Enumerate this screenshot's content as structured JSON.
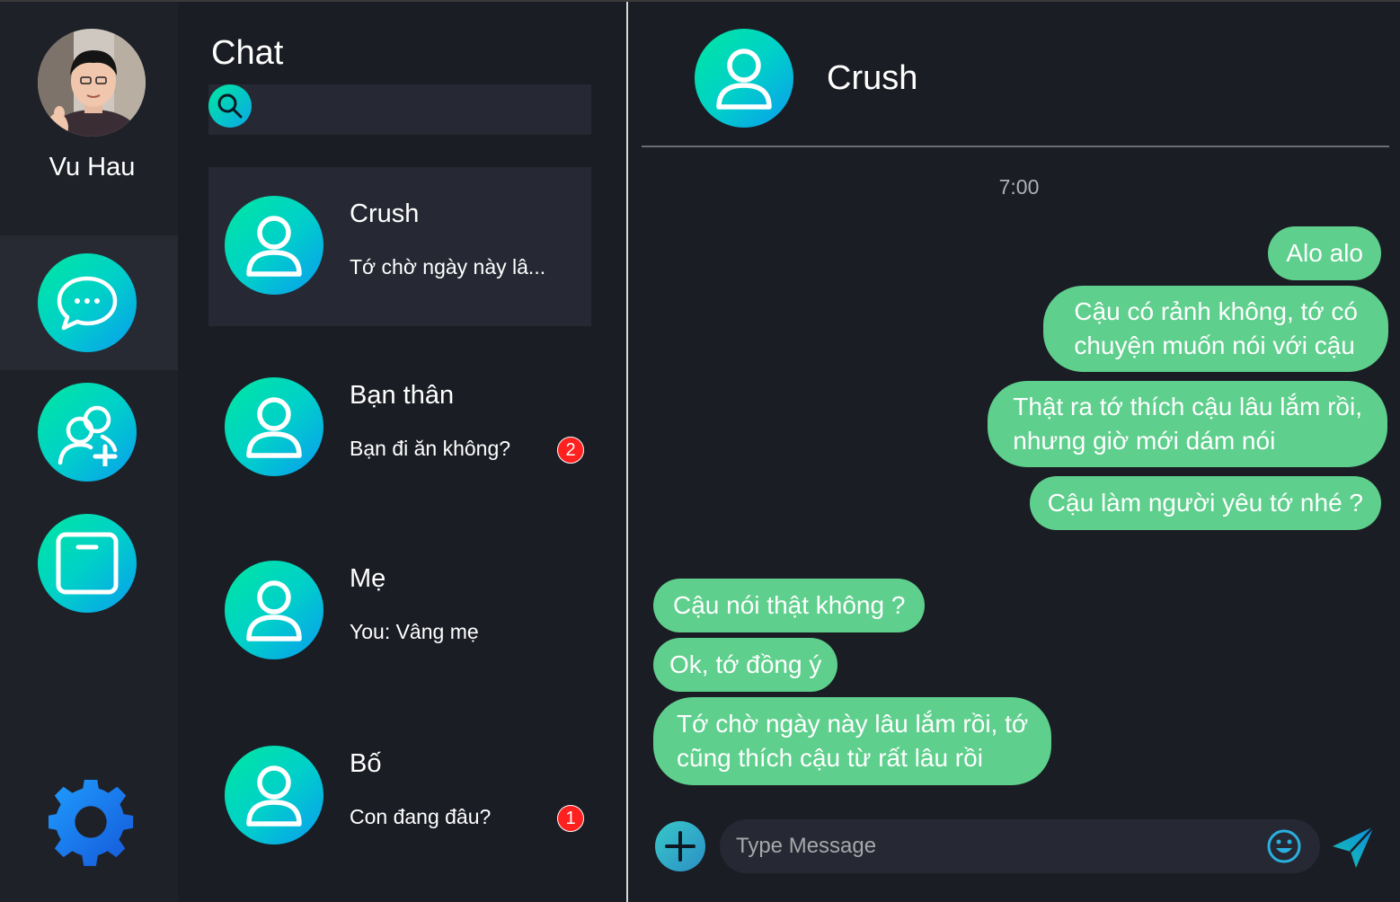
{
  "user": {
    "name": "Vu Hau"
  },
  "nav": {
    "items": [
      {
        "name": "chat",
        "icon": "chat-bubble-icon",
        "active": true
      },
      {
        "name": "add-friend",
        "icon": "add-user-icon",
        "active": false
      },
      {
        "name": "square",
        "icon": "square-icon",
        "active": false
      }
    ],
    "settings_icon": "gear-icon"
  },
  "chat_list": {
    "title": "Chat",
    "search": {
      "placeholder": "",
      "value": ""
    },
    "conversations": [
      {
        "name": "Crush",
        "preview": "Tớ chờ ngày này lâ...",
        "badge": "",
        "active": true
      },
      {
        "name": "Bạn thân",
        "preview": "Bạn đi ăn không?",
        "badge": "2",
        "active": false
      },
      {
        "name": "Mẹ",
        "preview": "You: Vâng mẹ",
        "badge": "",
        "active": false
      },
      {
        "name": "Bố",
        "preview": "Con đang đâu?",
        "badge": "1",
        "active": false
      }
    ]
  },
  "conversation": {
    "contact_name": "Crush",
    "timestamp": "7:00",
    "messages": [
      {
        "direction": "out",
        "lines": [
          "Alo alo"
        ]
      },
      {
        "direction": "out",
        "lines": [
          "Cậu có rảnh không, tớ có",
          "chuyện muốn nói với cậu"
        ]
      },
      {
        "direction": "out",
        "lines": [
          "Thật ra tớ thích cậu lâu lắm rồi,",
          "nhưng giờ mới dám nói"
        ]
      },
      {
        "direction": "out",
        "lines": [
          "Cậu làm người yêu tớ nhé ?"
        ]
      },
      {
        "direction": "in",
        "lines": [
          "Cậu nói thật không ?"
        ]
      },
      {
        "direction": "in",
        "lines": [
          "Ok, tớ đồng ý"
        ]
      },
      {
        "direction": "in",
        "lines": [
          "Tớ chờ ngày này lâu lắm rồi, tớ",
          "cũng thích cậu từ rất lâu rồi"
        ]
      }
    ],
    "composer": {
      "placeholder": "Type Message",
      "value": ""
    }
  },
  "colors": {
    "accent_start": "#00e7a0",
    "accent_end": "#0a9cf0",
    "bubble": "#5ecf8c",
    "badge": "#ff2020",
    "background": "#1b1d24"
  }
}
